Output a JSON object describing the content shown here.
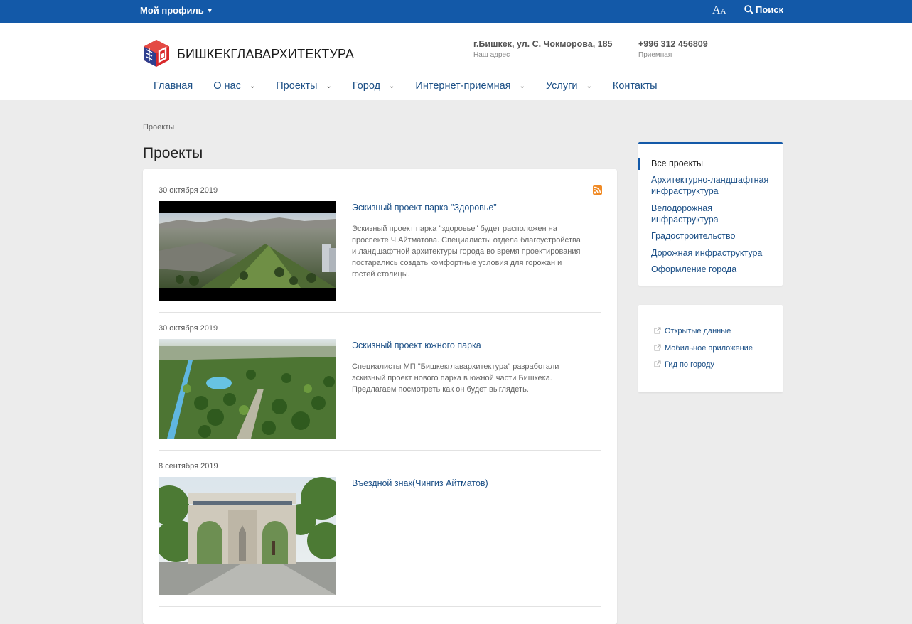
{
  "topbar": {
    "profile_label": "Мой профиль",
    "font_big": "A",
    "font_small": "A",
    "search_label": "Поиск"
  },
  "header": {
    "logo_text": "БИШКЕКГЛАВАРХИТЕКТУРА",
    "address": "г.Бишкек, ул. С. Чокморова, 185",
    "address_caption": "Наш адрес",
    "phone": "+996 312 456809",
    "phone_caption": "Приемная"
  },
  "nav": [
    {
      "label": "Главная"
    },
    {
      "label": "О нас"
    },
    {
      "label": "Проекты"
    },
    {
      "label": "Город"
    },
    {
      "label": "Интернет-приемная"
    },
    {
      "label": "Услуги"
    },
    {
      "label": "Контакты"
    }
  ],
  "breadcrumb": "Проекты",
  "page_title": "Проекты",
  "posts": [
    {
      "date": "30 октября 2019",
      "title": "Эскизный проект парка \"Здоровье\"",
      "desc": "Эскизный проект парка \"здоровье\" будет расположен на проспекте Ч.Айтматова. Специалисты отдела благоустройства и ландшафтной архитектуры города во время проектирования постарались создать комфортные условия для горожан и гостей столицы."
    },
    {
      "date": "30 октября 2019",
      "title": "Эскизный проект южного парка",
      "desc": "Специалисты МП \"Бишкекглавархитектура\" разработали эскизный проект нового парка в южной части Бишкека. Предлагаем посмотреть как он будет выглядеть."
    },
    {
      "date": "8 сентября 2019",
      "title": "Въездной знак(Чингиз Айтматов)",
      "desc": ""
    }
  ],
  "sidebar": {
    "categories": [
      "Все проекты",
      "Архитектурно-ландшафтная инфраструктура",
      "Велодорожная инфраструктура",
      "Градостроительство",
      "Дорожная инфраструктура",
      "Оформление города"
    ],
    "links": [
      "Открытые данные",
      "Мобильное приложение",
      "Гид по городу"
    ]
  },
  "colors": {
    "brand": "#1359a8",
    "link": "#1b4f86",
    "rss": "#f08a25"
  }
}
